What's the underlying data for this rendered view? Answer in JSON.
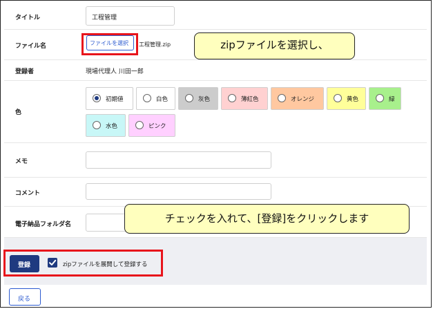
{
  "form": {
    "title": {
      "label": "タイトル",
      "value": "工程管理"
    },
    "file": {
      "label": "ファイル名",
      "button": "ファイルを選択",
      "filename": "工程管理.zip"
    },
    "registrant": {
      "label": "登録者",
      "value": "現場代理人 川田一郎"
    },
    "color": {
      "label": "色",
      "options": [
        {
          "label": "初期値",
          "bg": "#ffffff",
          "selected": true
        },
        {
          "label": "白色",
          "bg": "#ffffff",
          "selected": false
        },
        {
          "label": "灰色",
          "bg": "#cccccc",
          "selected": false
        },
        {
          "label": "薄紅色",
          "bg": "#ffd1d1",
          "selected": false
        },
        {
          "label": "オレンジ",
          "bg": "#ffc8a0",
          "selected": false
        },
        {
          "label": "黄色",
          "bg": "#ffff9a",
          "selected": false
        },
        {
          "label": "緑",
          "bg": "#a8f08c",
          "selected": false
        },
        {
          "label": "水色",
          "bg": "#c8f7f7",
          "selected": false
        },
        {
          "label": "ピンク",
          "bg": "#ffd0ff",
          "selected": false
        }
      ]
    },
    "memo": {
      "label": "メモ",
      "value": ""
    },
    "comment": {
      "label": "コメント",
      "value": ""
    },
    "folder": {
      "label": "電子納品フォルダ名",
      "value": ""
    }
  },
  "footer": {
    "register_button": "登録",
    "checkbox_label": "zipファイルを展開して登録する",
    "checkbox_checked": true,
    "back_button": "戻る"
  },
  "callouts": {
    "one": "zipファイルを選択し、",
    "two": "チェックを入れて、[登録]をクリックします"
  },
  "colors": {
    "primary": "#1f3a80",
    "highlight": "#e8141b",
    "callout_bg": "#ffffbe"
  }
}
